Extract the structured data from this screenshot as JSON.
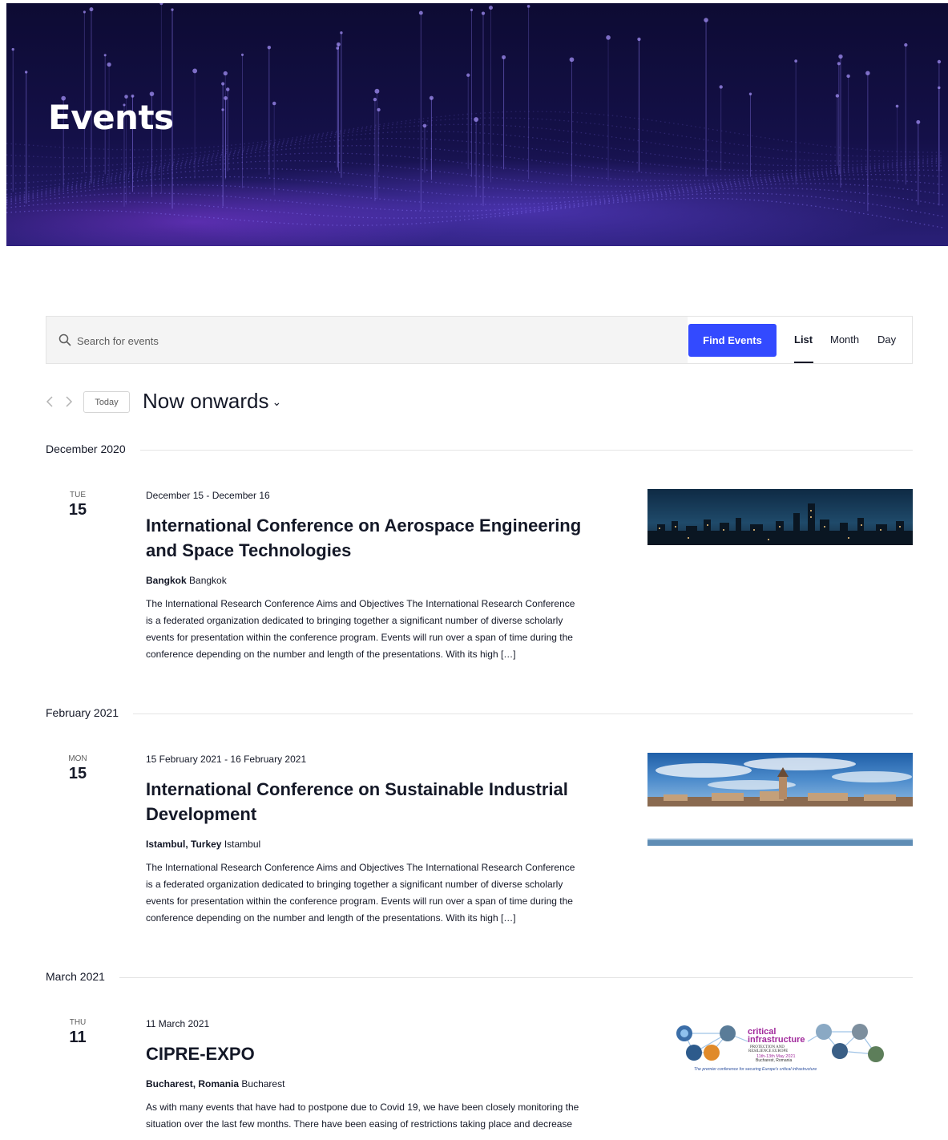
{
  "hero": {
    "title": "Events"
  },
  "search": {
    "placeholder": "Search for events",
    "find_button": "Find Events",
    "views": [
      "List",
      "Month",
      "Day"
    ],
    "active_view": "List"
  },
  "nav": {
    "today_label": "Today",
    "range_label": "Now onwards",
    "chevron_icon": "chevron-down-icon"
  },
  "months": [
    {
      "label": "December 2020",
      "events": [
        {
          "dow": "TUE",
          "day": "15",
          "when": "December 15 - December 16",
          "title_line1": "International Conference on Aerospace Engineering",
          "title_line2": "and Space Technologies",
          "venue_name": "Bangkok",
          "venue_city": "Bangkok",
          "desc_lines": [
            "The International Research Conference Aims and Objectives The International Research Conference",
            "is a federated organization dedicated to bringing together a significant number of diverse scholarly",
            "events for presentation within the conference program. Events will run over a span of time during the",
            "conference depending on the number and length of the presentations. With its high […]"
          ]
        }
      ]
    },
    {
      "label": "February 2021",
      "events": [
        {
          "dow": "MON",
          "day": "15",
          "when": "15 February 2021 - 16 February 2021",
          "title_line1": "International Conference on Sustainable Industrial",
          "title_line2": "Development",
          "venue_name": "Istambul, Turkey",
          "venue_city": "Istambul",
          "desc_lines": [
            "The International Research Conference Aims and Objectives The International Research Conference",
            "is a federated organization dedicated to bringing together a significant number of diverse scholarly",
            "events for presentation within the conference program. Events will run over a span of time during the",
            "conference depending on the number and length of the presentations. With its high […]"
          ]
        }
      ]
    },
    {
      "label": "March 2021",
      "events": [
        {
          "dow": "THU",
          "day": "11",
          "when": "11 March 2021",
          "title_line1": "CIPRE-EXPO",
          "title_line2": "",
          "venue_name": "Bucharest, Romania",
          "venue_city": "Bucharest",
          "desc_lines": [
            "As with many events that have had to postpone due to Covid 19, we have been closely monitoring the",
            "situation over the last few months.  There have been easing of restrictions taking place and decrease"
          ],
          "image_text": {
            "line1": "critical",
            "line2": "infrastructure",
            "line3": "PROTECTION AND",
            "line4": "RESILIENCE EUROPE",
            "line5": "11th-13th May 2021",
            "line6": "Bucharest, Romania",
            "tagline": "The premier conference for securing Europe's critical infrastructure"
          }
        }
      ]
    }
  ],
  "colors": {
    "accent": "#334aff",
    "text": "#141827",
    "hero_bg": "#141048"
  }
}
